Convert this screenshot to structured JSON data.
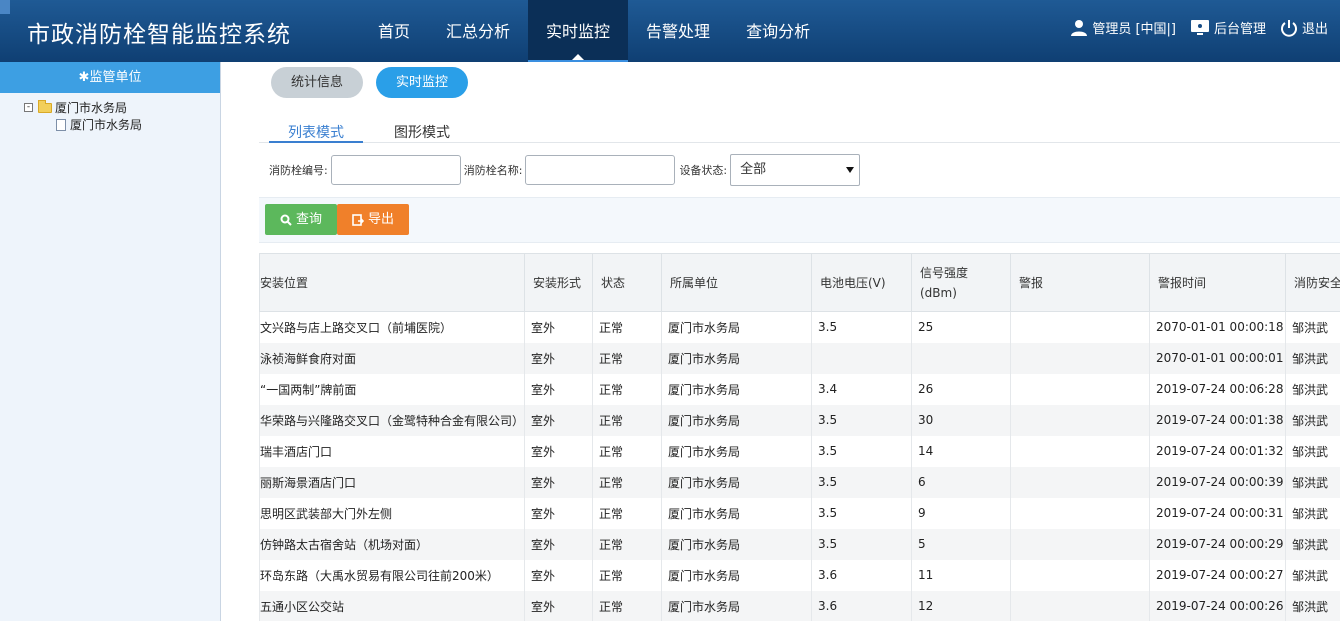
{
  "header": {
    "title": "市政消防栓智能监控系统",
    "nav": [
      {
        "label": "首页",
        "active": false
      },
      {
        "label": "汇总分析",
        "active": false
      },
      {
        "label": "实时监控",
        "active": true
      },
      {
        "label": "告警处理",
        "active": false
      },
      {
        "label": "查询分析",
        "active": false
      }
    ],
    "user_label": "管理员 [中国|]",
    "admin_label": "后台管理",
    "logout_label": "退出"
  },
  "sidebar": {
    "title": "监管单位",
    "tree_root": "厦门市水务局",
    "tree_child": "厦门市水务局",
    "toggle_symbol": "⊟"
  },
  "tabs": {
    "stats_label": "统计信息",
    "live_label": "实时监控"
  },
  "view_modes": {
    "list_label": "列表模式",
    "graph_label": "图形模式"
  },
  "filters": {
    "hydrant_no_label": "消防栓编号:",
    "hydrant_no_value": "",
    "hydrant_name_label": "消防栓名称:",
    "hydrant_name_value": "",
    "status_label": "设备状态:",
    "status_value": "全部"
  },
  "actions": {
    "query_label": "查询",
    "export_label": "导出"
  },
  "table": {
    "headers": [
      "安装位置",
      "安装形式",
      "状态",
      "所属单位",
      "电池电压(V)",
      "信号强度(dBm)",
      "警报",
      "警报时间",
      "消防安全"
    ],
    "rows": [
      [
        "文兴路与店上路交叉口（前埔医院）",
        "室外",
        "正常",
        "厦门市水务局",
        "3.5",
        "25",
        "",
        "2070-01-01 00:00:18",
        "邹洪武"
      ],
      [
        "泳祯海鲜食府对面",
        "室外",
        "正常",
        "厦门市水务局",
        "",
        "",
        "",
        "2070-01-01 00:00:01",
        "邹洪武"
      ],
      [
        "“一国两制”牌前面",
        "室外",
        "正常",
        "厦门市水务局",
        "3.4",
        "26",
        "",
        "2019-07-24 00:06:28",
        "邹洪武"
      ],
      [
        "华荣路与兴隆路交叉口（金鹭特种合金有限公司）",
        "室外",
        "正常",
        "厦门市水务局",
        "3.5",
        "30",
        "",
        "2019-07-24 00:01:38",
        "邹洪武"
      ],
      [
        "瑞丰酒店门口",
        "室外",
        "正常",
        "厦门市水务局",
        "3.5",
        "14",
        "",
        "2019-07-24 00:01:32",
        "邹洪武"
      ],
      [
        "丽斯海景酒店门口",
        "室外",
        "正常",
        "厦门市水务局",
        "3.5",
        "6",
        "",
        "2019-07-24 00:00:39",
        "邹洪武"
      ],
      [
        "思明区武装部大门外左侧",
        "室外",
        "正常",
        "厦门市水务局",
        "3.5",
        "9",
        "",
        "2019-07-24 00:00:31",
        "邹洪武"
      ],
      [
        "仿钟路太古宿舍站（机场对面）",
        "室外",
        "正常",
        "厦门市水务局",
        "3.5",
        "5",
        "",
        "2019-07-24 00:00:29",
        "邹洪武"
      ],
      [
        "环岛东路（大禹水贸易有限公司往前200米）",
        "室外",
        "正常",
        "厦门市水务局",
        "3.6",
        "11",
        "",
        "2019-07-24 00:00:27",
        "邹洪武"
      ],
      [
        "五通小区公交站",
        "室外",
        "正常",
        "厦门市水务局",
        "3.6",
        "12",
        "",
        "2019-07-24 00:00:26",
        "邹洪武"
      ]
    ]
  },
  "colors": {
    "header_bg": "#174c85",
    "accent": "#2a9fe8",
    "query_btn": "#5cb85c",
    "export_btn": "#f0802a"
  }
}
